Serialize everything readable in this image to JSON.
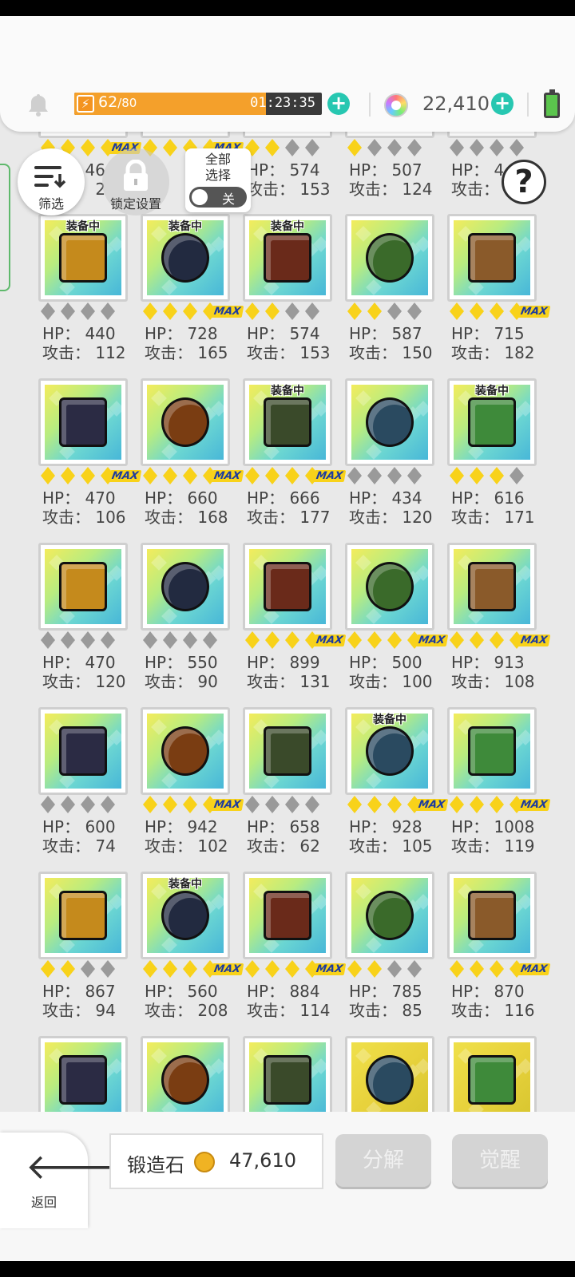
{
  "header": {
    "energy_current": "62",
    "energy_max": "/80",
    "energy_fraction": 0.775,
    "timer": "01:23:35",
    "gem_count": "22,410",
    "colors": {
      "accent": "#27c7b1",
      "energy": "#f4a02b"
    }
  },
  "toolbar": {
    "filter_label": "筛选",
    "lock_label": "锁定设置",
    "select_all_label": "全部\n选择",
    "toggle_label": "关"
  },
  "equipped_label": "装备中",
  "rows": [
    {
      "items": [
        {
          "hp": "HP： 46",
          "atk": "攻击： 2",
          "stars": [
            1,
            1,
            1,
            1
          ],
          "max": true
        },
        {
          "hp": "",
          "atk": "",
          "stars": [
            1,
            1,
            1,
            1
          ],
          "max": true
        },
        {
          "hp": "HP： 574",
          "atk": "攻击： 153",
          "stars": [
            1,
            1,
            0,
            0
          ],
          "max": false
        },
        {
          "hp": "HP： 507",
          "atk": "攻击： 124",
          "stars": [
            1,
            0,
            0,
            0
          ],
          "max": false
        },
        {
          "hp": "HP： 4",
          "atk": "攻击：",
          "stars": [
            0,
            0,
            0,
            0
          ],
          "max": false
        }
      ]
    },
    {
      "items": [
        {
          "icon": "book-dark-icon",
          "equipped": true,
          "hp": "HP： 440",
          "atk": "攻击： 112",
          "stars": [
            0,
            0,
            0,
            0
          ],
          "max": false
        },
        {
          "icon": "book-phoenix-icon",
          "equipped": true,
          "hp": "HP： 728",
          "atk": "攻击： 165",
          "stars": [
            1,
            1,
            1,
            1
          ],
          "max": true
        },
        {
          "icon": "book-emerald-icon",
          "equipped": true,
          "hp": "HP： 574",
          "atk": "攻击： 153",
          "stars": [
            1,
            1,
            0,
            0
          ],
          "max": false
        },
        {
          "icon": "book-tablet-icon",
          "equipped": false,
          "hp": "HP： 587",
          "atk": "攻击： 150",
          "stars": [
            1,
            1,
            0,
            0
          ],
          "max": false
        },
        {
          "icon": "book-creeper-icon",
          "equipped": false,
          "hp": "HP： 715",
          "atk": "攻击： 182",
          "stars": [
            1,
            1,
            1,
            1
          ],
          "max": true
        }
      ]
    },
    {
      "items": [
        {
          "icon": "book-sun-icon",
          "equipped": false,
          "hp": "HP： 470",
          "atk": "攻击： 106",
          "stars": [
            1,
            1,
            1,
            1
          ],
          "max": true
        },
        {
          "icon": "pickaxe-icon",
          "equipped": false,
          "hp": "HP： 660",
          "atk": "攻击： 168",
          "stars": [
            1,
            1,
            1,
            1
          ],
          "max": true
        },
        {
          "icon": "fire-staff-icon",
          "equipped": true,
          "hp": "HP： 666",
          "atk": "攻击： 177",
          "stars": [
            1,
            1,
            1,
            1
          ],
          "max": true
        },
        {
          "icon": "holly-staff-icon",
          "equipped": false,
          "hp": "HP： 434",
          "atk": "攻击： 120",
          "stars": [
            0,
            0,
            0,
            0
          ],
          "max": false
        },
        {
          "icon": "scroll-fan-icon",
          "equipped": true,
          "hp": "HP： 616",
          "atk": "攻击： 171",
          "stars": [
            1,
            1,
            1,
            0
          ],
          "max": false
        }
      ]
    },
    {
      "items": [
        {
          "icon": "bell-icon",
          "equipped": false,
          "hp": "HP： 470",
          "atk": "攻击： 120",
          "stars": [
            0,
            0,
            0,
            0
          ],
          "max": false
        },
        {
          "icon": "shield-icon",
          "equipped": false,
          "hp": "HP： 550",
          "atk": "攻击： 90",
          "stars": [
            0,
            0,
            0,
            0
          ],
          "max": false
        },
        {
          "icon": "wreath-icon",
          "equipped": false,
          "hp": "HP： 899",
          "atk": "攻击： 131",
          "stars": [
            1,
            1,
            1,
            1
          ],
          "max": true
        },
        {
          "icon": "gold-emblem-icon",
          "equipped": false,
          "hp": "HP： 500",
          "atk": "攻击： 100",
          "stars": [
            1,
            1,
            1,
            1
          ],
          "max": true
        },
        {
          "icon": "potion-necklace-icon",
          "equipped": false,
          "hp": "HP： 913",
          "atk": "攻击： 108",
          "stars": [
            1,
            1,
            1,
            1
          ],
          "max": true
        }
      ]
    },
    {
      "items": [
        {
          "icon": "sd-card-icon",
          "equipped": false,
          "hp": "HP： 600",
          "atk": "攻击： 74",
          "stars": [
            0,
            0,
            0,
            0
          ],
          "max": false
        },
        {
          "icon": "tooth-necklace-icon",
          "equipped": false,
          "hp": "HP： 942",
          "atk": "攻击： 102",
          "stars": [
            1,
            1,
            1,
            1
          ],
          "max": true
        },
        {
          "icon": "blue-potion-icon",
          "equipped": false,
          "hp": "HP： 658",
          "atk": "攻击： 62",
          "stars": [
            0,
            0,
            0,
            0
          ],
          "max": false
        },
        {
          "icon": "purple-bracer-icon",
          "equipped": true,
          "hp": "HP： 928",
          "atk": "攻击： 105",
          "stars": [
            1,
            1,
            1,
            1
          ],
          "max": true
        },
        {
          "icon": "crystal-icon",
          "equipped": false,
          "hp": "HP： 1008",
          "atk": "攻击： 119",
          "stars": [
            1,
            1,
            1,
            1
          ],
          "max": true
        }
      ]
    },
    {
      "items": [
        {
          "icon": "cloth-icon",
          "equipped": false,
          "hp": "HP： 867",
          "atk": "攻击： 94",
          "stars": [
            1,
            1,
            0,
            0
          ],
          "max": false
        },
        {
          "icon": "dark-orb-icon",
          "equipped": true,
          "hp": "HP： 560",
          "atk": "攻击： 208",
          "stars": [
            1,
            1,
            1,
            1
          ],
          "max": true
        },
        {
          "icon": "amethyst-necklace-icon",
          "equipped": false,
          "hp": "HP： 884",
          "atk": "攻击： 114",
          "stars": [
            1,
            1,
            1,
            1
          ],
          "max": true
        },
        {
          "icon": "jade-necklace-icon",
          "equipped": false,
          "hp": "HP： 785",
          "atk": "攻击： 85",
          "stars": [
            1,
            1,
            0,
            0
          ],
          "max": false
        },
        {
          "icon": "bracelet-icon",
          "equipped": false,
          "hp": "HP： 870",
          "atk": "攻击： 116",
          "stars": [
            1,
            1,
            1,
            1
          ],
          "max": true
        }
      ]
    },
    {
      "items": [
        {
          "icon": "lightning-frame-icon",
          "equipped": false
        },
        {
          "icon": "rifle-icon",
          "equipped": false
        },
        {
          "icon": "sniper-icon",
          "equipped": false
        },
        {
          "icon": "ice-sword-icon",
          "equipped": false,
          "gold": true
        },
        {
          "icon": "cleaver-icon",
          "equipped": false,
          "gold": true
        }
      ]
    }
  ],
  "bottom": {
    "back_label": "返回",
    "stone_label": "锻造石",
    "stone_value": "47,610",
    "decompose_label": "分解",
    "awaken_label": "觉醒"
  }
}
